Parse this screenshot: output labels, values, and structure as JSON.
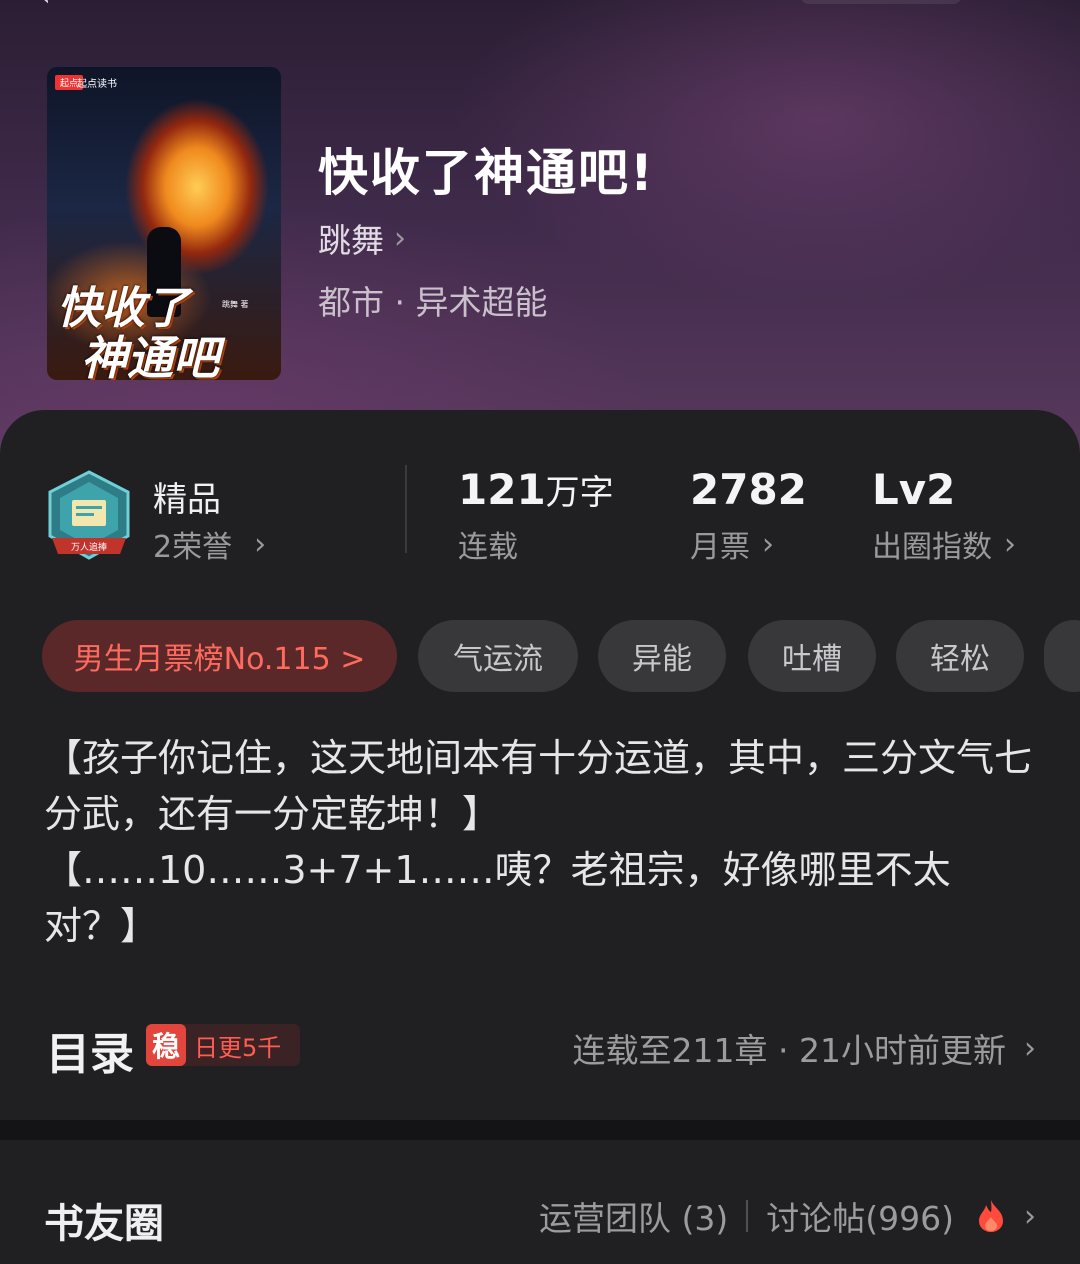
{
  "book": {
    "title": "快收了神通吧!",
    "author": "跳舞",
    "genre": "都市 · 异术超能"
  },
  "cover": {
    "badge": "起点",
    "brand": "起点读书",
    "title_line1": "快收了",
    "title_line2": "神通吧",
    "author_mark": "跳舞 著"
  },
  "honor": {
    "title": "精品",
    "subtitle": "2荣誉",
    "icon_caption": "万人追捧"
  },
  "stats": [
    {
      "value": "121",
      "unit": "万字",
      "label": "连载"
    },
    {
      "value": "2782",
      "label": "月票"
    },
    {
      "value": "Lv2",
      "label": "出圈指数"
    }
  ],
  "tags": [
    {
      "label": "男生月票榜No.115 >"
    },
    {
      "label": "气运流"
    },
    {
      "label": "异能"
    },
    {
      "label": "吐槽"
    },
    {
      "label": "轻松"
    }
  ],
  "intro": [
    "【孩子你记住，这天地间本有十分运道，其中，三分文气七分武，还有一分定乾坤！】",
    "【……10……3+7+1……咦？老祖宗，好像哪里不太对？】"
  ],
  "toc": {
    "title": "目录",
    "badge_icon": "稳",
    "badge_text": "日更5千",
    "status": "连载至211章 · 21小时前更新"
  },
  "community": {
    "title": "书友圈",
    "team": "运营团队 (3)",
    "posts": "讨论帖(996)"
  },
  "colors": {
    "accent_red": "#e2453c",
    "panel": "#202022"
  }
}
